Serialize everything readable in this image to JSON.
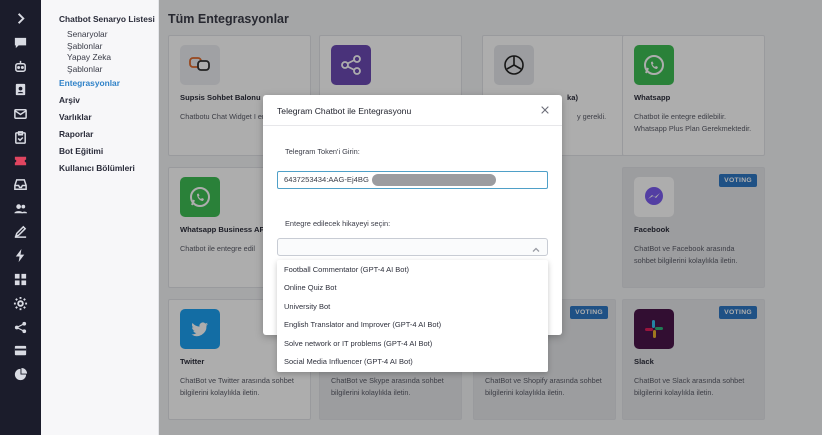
{
  "rail": {
    "icons": [
      "chevron-right-icon",
      "chat-icon",
      "robot-icon",
      "contacts-icon",
      "mail-icon",
      "clipboard-icon",
      "ticket-icon",
      "inbox-icon",
      "users-icon",
      "edit-icon",
      "bolt-icon",
      "grid-icon",
      "settings-icon",
      "share-icon",
      "card-icon",
      "pie-chart-icon"
    ]
  },
  "menu": {
    "scenario_heading": "Chatbot Senaryo Listesi",
    "sub_items": [
      "Senaryolar",
      "Şablonlar",
      "Yapay Zeka",
      "Şablonlar"
    ],
    "items": [
      {
        "label": "Entegrasyonlar",
        "active": true
      },
      {
        "label": "Arşiv",
        "active": false
      },
      {
        "label": "Varlıklar",
        "active": false
      },
      {
        "label": "Raporlar",
        "active": false
      },
      {
        "label": "Bot Eğitimi",
        "active": false
      },
      {
        "label": "Kullanıcı Bölümleri",
        "active": false
      }
    ]
  },
  "main": {
    "title": "Tüm Entegrasyonlar",
    "cards": [
      {
        "title": "Supsis Sohbet Balonu",
        "desc": "Chatbotu Chat Widget I entegre edin.",
        "badge": "",
        "logo": "supsis-bubble-icon"
      },
      {
        "title": "",
        "desc": "",
        "badge": "",
        "logo": "share-network-icon"
      },
      {
        "title": "ka)",
        "desc": "y gerekli.",
        "badge": "",
        "logo": "openai-icon"
      },
      {
        "title": "Whatsapp",
        "desc": "Chatbot ile entegre edilebilir. Whatsapp Plus Plan Gerekmektedir.",
        "badge": "",
        "logo": "whatsapp-icon"
      },
      {
        "title": "Whatsapp Business AP",
        "desc": "Chatbot ile entegre edil",
        "badge": "",
        "logo": "whatsapp-icon"
      },
      {
        "title": "Facebook",
        "desc": "ChatBot ve Facebook arasında sohbet bilgilerini kolaylıkla iletin.",
        "badge": "VOTING",
        "logo": "messenger-icon"
      },
      {
        "title": "Twitter",
        "desc": "ChatBot ve Twitter arasında sohbet bilgilerini kolaylıkla iletin.",
        "badge": "",
        "logo": "twitter-icon"
      },
      {
        "title": "",
        "desc": "ChatBot ve Skype arasında sohbet bilgilerini kolaylıkla iletin.",
        "badge": "",
        "logo": ""
      },
      {
        "title": "",
        "desc": "ChatBot ve Shopify arasında sohbet bilgilerini kolaylıkla iletin.",
        "badge": "VOTING",
        "logo": ""
      },
      {
        "title": "Slack",
        "desc": "ChatBot ve Slack arasında sohbet bilgilerini kolaylıkla iletin.",
        "badge": "VOTING",
        "logo": "slack-icon"
      }
    ]
  },
  "modal": {
    "title": "Telegram Chatbot ile Entegrasyonu",
    "token_label": "Telegram Token'i Girin:",
    "token_value": "6437253434:AAG-Ej4BG",
    "story_label": "Entegre edilecek hikayeyi seçin:",
    "options": [
      "Football Commentator (GPT-4 AI Bot)",
      "Online Quiz Bot",
      "University Bot",
      "English Translator and Improver (GPT-4 AI Bot)",
      "Solve network or IT problems (GPT-4 AI Bot)",
      "Social Media Influencer (GPT-4 AI Bot)"
    ]
  },
  "colors": {
    "rail": "#1b1c2b",
    "active_menu": "#2f82c8",
    "badge": "#2f78c4",
    "whatsapp": "#3fbf55",
    "twitter": "#1da1f2"
  }
}
